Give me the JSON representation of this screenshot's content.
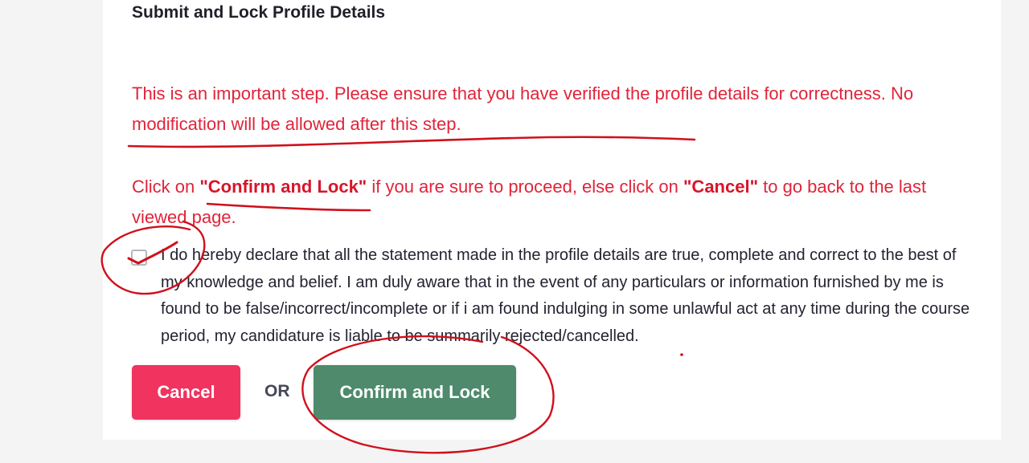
{
  "section": {
    "title": "Submit and Lock Profile Details"
  },
  "warning": {
    "line1": "This is an important step. Please ensure that you have verified the profile details for correctness. No modification will be allowed after this step.",
    "instruction_prefix": "Click on ",
    "confirm_ref": "\"Confirm and Lock\"",
    "instruction_middle": " if you are sure to proceed, else click on ",
    "cancel_ref": "\"Cancel\"",
    "instruction_suffix": " to go back to the last viewed page."
  },
  "declaration": {
    "checked": false,
    "text": "I do hereby declare that all the statement made in the profile details are true, complete and correct to the best of my knowledge and belief. I am duly aware that in the event of any particulars or information furnished by me is found to be false/incorrect/incomplete or if i am found indulging in some unlawful act at any time during the course period, my candidature is liable to be summarily rejected/cancelled."
  },
  "actions": {
    "cancel_label": "Cancel",
    "or_label": "OR",
    "confirm_label": "Confirm and Lock"
  },
  "colors": {
    "warning_text": "#e0243a",
    "cancel_button": "#f0335f",
    "confirm_button": "#4e8a6b",
    "annotation_ink": "#d0101c"
  }
}
